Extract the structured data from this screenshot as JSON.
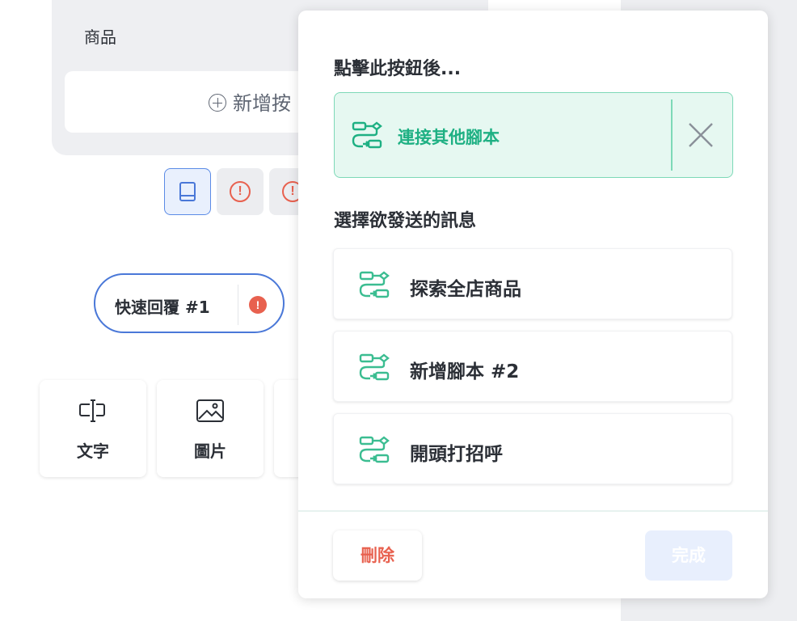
{
  "background": {
    "product_card": {
      "label": "商品",
      "add_button_label": "新增按"
    },
    "toolbar": {
      "warn_glyph": "!"
    },
    "quick_reply": {
      "label": "快速回覆 #1",
      "warn_glyph": "!"
    },
    "content_tiles": [
      {
        "label": "文字",
        "icon": "text-cursor-icon"
      },
      {
        "label": "圖片",
        "icon": "image-icon"
      }
    ]
  },
  "panel": {
    "title": "點擊此按鈕後...",
    "selected_option": {
      "label": "連接其他腳本",
      "icon": "flow-icon"
    },
    "section_title": "選擇欲發送的訊息",
    "options": [
      {
        "label": "探索全店商品",
        "icon": "flow-icon"
      },
      {
        "label": "新增腳本 #2",
        "icon": "flow-icon"
      },
      {
        "label": "開頭打招呼",
        "icon": "flow-icon"
      }
    ],
    "delete_label": "刪除",
    "done_label": "完成"
  },
  "colors": {
    "accent_blue": "#4a78d8",
    "accent_green": "#1eb083",
    "danger": "#e8614f",
    "done_disabled_bg": "#e8effd"
  }
}
